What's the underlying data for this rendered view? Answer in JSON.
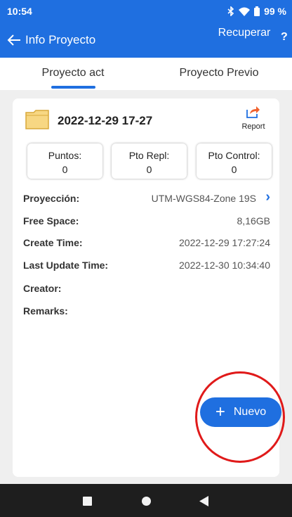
{
  "status_bar": {
    "time": "10:54",
    "battery": "99 %",
    "icons": [
      "bluetooth-icon",
      "wifi-icon",
      "battery-icon"
    ]
  },
  "app_bar": {
    "back_icon": "arrow-left-icon",
    "title": "Info Proyecto",
    "recover_label": "Recuperar",
    "help_label": "?"
  },
  "tabs": [
    {
      "label": "Proyecto act",
      "active": true
    },
    {
      "label": "Proyecto Previo",
      "active": false
    }
  ],
  "project": {
    "icon": "folder-icon",
    "date": "2022-12-29 17-27",
    "report_label": "Report",
    "report_icon": "share-icon"
  },
  "stats": [
    {
      "label": "Puntos:",
      "value": "0"
    },
    {
      "label": "Pto Repl:",
      "value": "0"
    },
    {
      "label": "Pto Control:",
      "value": "0"
    }
  ],
  "info": [
    {
      "key": "Proyección:",
      "value": "UTM-WGS84-Zone 19S"
    },
    {
      "key": "Free Space:",
      "value": "8,16GB"
    },
    {
      "key": "Create Time:",
      "value": "2022-12-29 17:27:24"
    },
    {
      "key": "Last Update Time:",
      "value": "2022-12-30 10:34:40"
    },
    {
      "key": "Creator:",
      "value": ""
    },
    {
      "key": "Remarks:",
      "value": ""
    }
  ],
  "fab": {
    "plus": "+",
    "label": "Nuevo"
  },
  "nav_bar": {
    "icons": [
      "recents-icon",
      "home-icon",
      "back-icon"
    ]
  },
  "colors": {
    "primary": "#1f6fe0",
    "highlight": "#e01a1a",
    "background": "#efefef"
  }
}
